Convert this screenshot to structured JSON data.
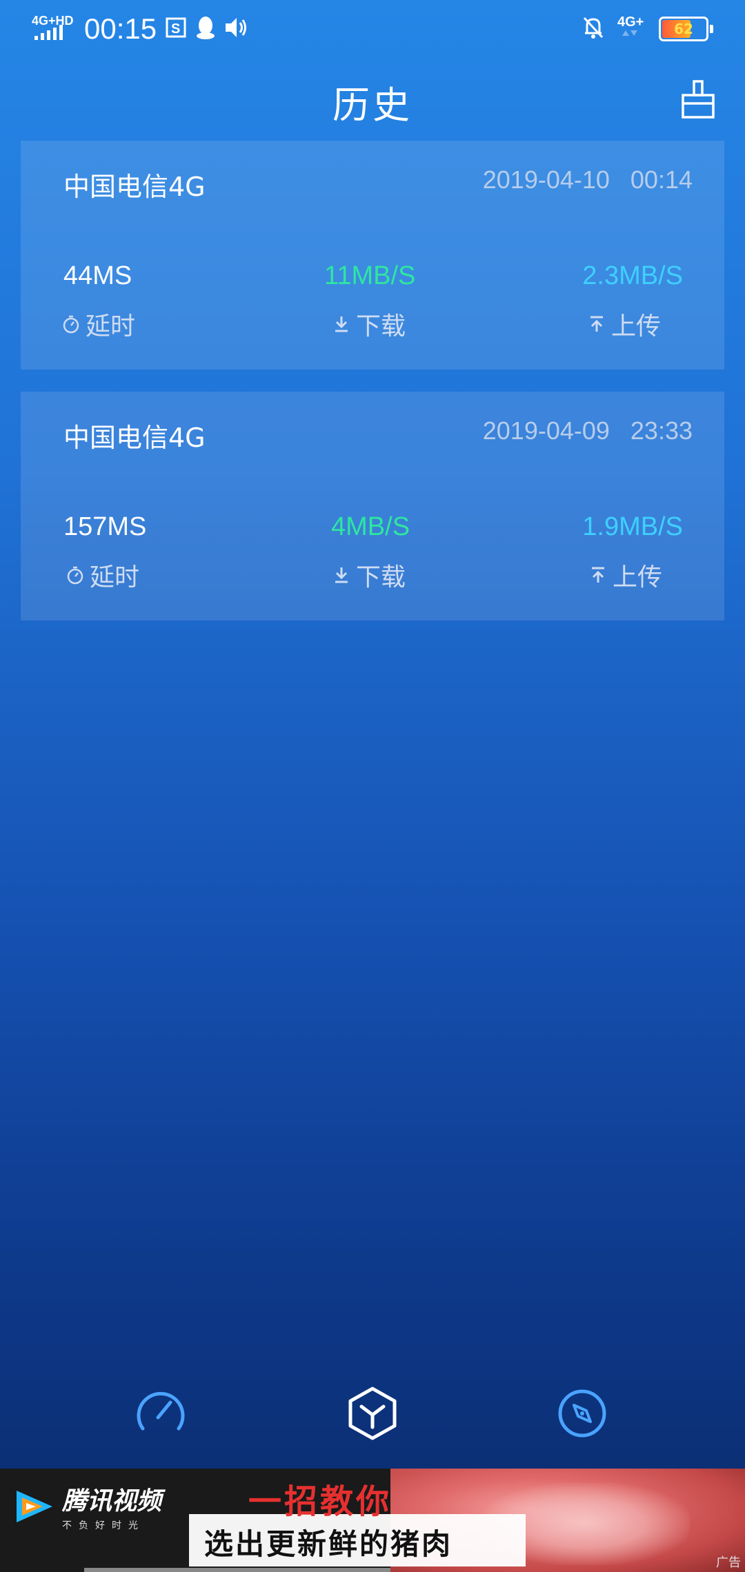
{
  "status_bar": {
    "network_left": "4G+HD",
    "time": "00:15",
    "network_right": "4G+",
    "battery": "62"
  },
  "header": {
    "title": "历史"
  },
  "records": [
    {
      "carrier": "中国电信4G",
      "datetime": "2019-04-10   00:14",
      "latency": "44MS",
      "download": "11MB/S",
      "upload": "2.3MB/S",
      "latency_label": "延时",
      "download_label": "下载",
      "upload_label": "上传"
    },
    {
      "carrier": "中国电信4G",
      "datetime": "2019-04-09   23:33",
      "latency": "157MS",
      "download": "4MB/S",
      "upload": "1.9MB/S",
      "latency_label": "延时",
      "download_label": "下载",
      "upload_label": "上传"
    }
  ],
  "tabbar": {
    "icons": [
      "speedometer-icon",
      "hexagon-y-icon",
      "compass-icon"
    ]
  },
  "ad": {
    "brand": "腾讯视频",
    "slogan": "不负好时光",
    "caption_line1": "一招教你",
    "caption_line2": "选出更新鲜的猪肉",
    "tag": "广告"
  },
  "colors": {
    "download": "#2ee6a0",
    "upload": "#3ed0ff",
    "bg_top": "#2586e6",
    "bg_bottom": "#0a2a6a"
  }
}
